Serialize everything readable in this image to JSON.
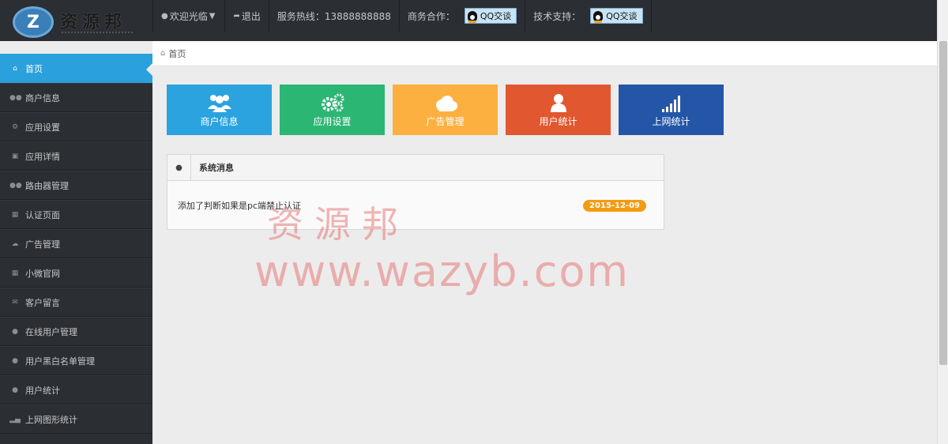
{
  "logo": {
    "badge": "Z",
    "text": "资源邦"
  },
  "header": {
    "welcome": "欢迎光临",
    "logout": "退出",
    "hotline": "服务热线：13888888888",
    "business": "商务合作：",
    "tech": "技术支持：",
    "qq_label": "QQ交谈"
  },
  "sidebar": {
    "items": [
      {
        "label": "首页",
        "icon": "home-icon"
      },
      {
        "label": "商户信息",
        "icon": "users-icon"
      },
      {
        "label": "应用设置",
        "icon": "gears-icon"
      },
      {
        "label": "应用详情",
        "icon": "check-square-icon"
      },
      {
        "label": "路由器管理",
        "icon": "users-icon"
      },
      {
        "label": "认证页面",
        "icon": "grid-icon"
      },
      {
        "label": "广告管理",
        "icon": "cloud-icon"
      },
      {
        "label": "小微官网",
        "icon": "grid-icon"
      },
      {
        "label": "客户留言",
        "icon": "envelope-icon"
      },
      {
        "label": "在线用户管理",
        "icon": "user-icon"
      },
      {
        "label": "用户黑白名单管理",
        "icon": "user-icon"
      },
      {
        "label": "用户统计",
        "icon": "user-icon"
      },
      {
        "label": "上网图形统计",
        "icon": "signal-icon"
      }
    ]
  },
  "breadcrumb": {
    "label": "首页"
  },
  "tiles": [
    {
      "label": "商户信息",
      "color": "#2aa3df",
      "icon": "users-icon"
    },
    {
      "label": "应用设置",
      "color": "#2bb673",
      "icon": "gears-icon"
    },
    {
      "label": "广告管理",
      "color": "#fbb040",
      "icon": "cloud-icon"
    },
    {
      "label": "用户统计",
      "color": "#e1572f",
      "icon": "user-icon"
    },
    {
      "label": "上网统计",
      "color": "#2456a8",
      "icon": "signal-icon"
    }
  ],
  "panel": {
    "title": "系统消息",
    "message": "添加了判断如果是pc端禁止认证",
    "date": "2015-12-09"
  },
  "watermark": {
    "line1": "资源邦",
    "line2": "www.wazyb.com"
  }
}
